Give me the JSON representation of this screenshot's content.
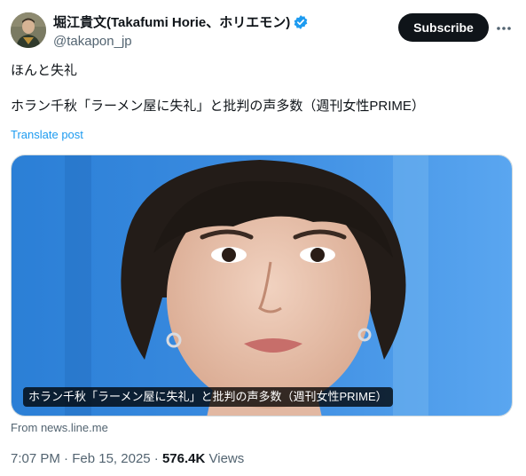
{
  "author": {
    "display_name": "堀江貴文(Takafumi Horie、ホリエモン)",
    "handle": "@takapon_jp",
    "avatar_icon": "avatar-photo",
    "verified_icon": "verified-badge-icon",
    "verified_color": "#1d9bf0"
  },
  "actions": {
    "subscribe_label": "Subscribe",
    "more_icon": "more-options-icon"
  },
  "tweet": {
    "line1": "ほんと失礼",
    "line2": "ホラン千秋「ラーメン屋に失礼」と批判の声多数（週刊女性PRIME）",
    "translate_label": "Translate post"
  },
  "card": {
    "caption": "ホラン千秋「ラーメン屋に失礼」と批判の声多数（週刊女性PRIME）",
    "source": "From news.line.me"
  },
  "meta": {
    "time": "7:07 PM",
    "separator": "·",
    "date": "Feb 15, 2025",
    "views_count": "576.4K",
    "views_label": "Views"
  },
  "colors": {
    "text_primary": "#0f1419",
    "text_secondary": "#536471",
    "accent": "#1d9bf0",
    "button_bg": "#0f1419"
  }
}
